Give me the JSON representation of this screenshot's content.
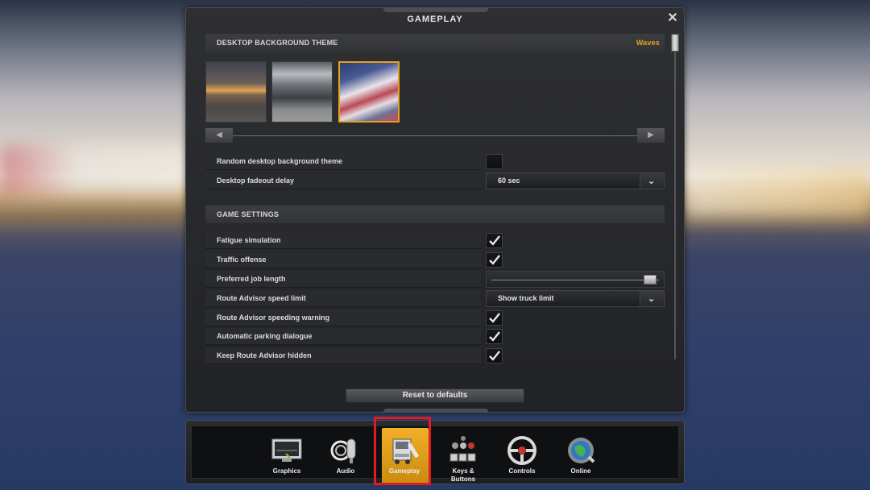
{
  "dialog": {
    "title": "GAMEPLAY",
    "close_glyph": "✕",
    "sections": {
      "background": {
        "label": "DESKTOP BACKGROUND THEME",
        "value": "Waves"
      },
      "game": {
        "label": "GAME SETTINGS"
      }
    },
    "background_options": {
      "random_label": "Random desktop background theme",
      "random_checked": false,
      "fadeout_label": "Desktop fadeout delay",
      "fadeout_value": "60 sec"
    },
    "game_settings": {
      "fatigue": {
        "label": "Fatigue simulation",
        "checked": true
      },
      "traffic": {
        "label": "Traffic offense",
        "checked": true
      },
      "job_length": {
        "label": "Preferred job length",
        "level": 0.97
      },
      "speed_limit": {
        "label": "Route Advisor speed limit",
        "value": "Show truck limit"
      },
      "speeding": {
        "label": "Route Advisor speeding warning",
        "checked": true
      },
      "parking": {
        "label": "Automatic parking dialogue",
        "checked": true
      },
      "hidden": {
        "label": "Keep Route Advisor hidden",
        "checked": true
      }
    },
    "reset_label": "Reset to defaults"
  },
  "toolbar": {
    "graphics": "Graphics",
    "audio": "Audio",
    "gameplay": "Gameplay",
    "keys_1": "Keys &",
    "keys_2": "Buttons",
    "controls": "Controls",
    "online": "Online"
  },
  "colors": {
    "accent": "#e6a21d",
    "active_tab": "#e6a21d",
    "highlight": "#e01a26"
  }
}
